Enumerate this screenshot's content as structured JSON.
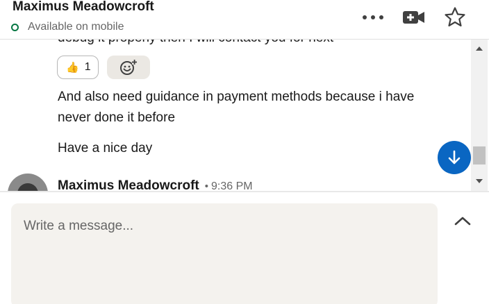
{
  "header": {
    "contact_name": "Maximus Meadowcroft",
    "status": "Available on mobile",
    "status_color": "#057642",
    "icons": [
      "more-options-icon",
      "video-call-icon",
      "star-icon"
    ]
  },
  "messages": {
    "cutoff_text": "debug it properly then I will contact you for next",
    "reaction": {
      "emoji": "👍",
      "count": "1"
    },
    "items": [
      {
        "text": "And also need guidance in payment methods because i have never done it before"
      },
      {
        "text": "Have a nice day"
      }
    ],
    "next_sender": {
      "name": "Maximus Meadowcroft",
      "separator": "•",
      "time": "9:36 PM"
    }
  },
  "compose": {
    "placeholder": "Write a message..."
  },
  "colors": {
    "accent": "#0a66c2",
    "compose_bg": "#f4f2ee",
    "add_reaction_bg": "#ebe8e3"
  }
}
